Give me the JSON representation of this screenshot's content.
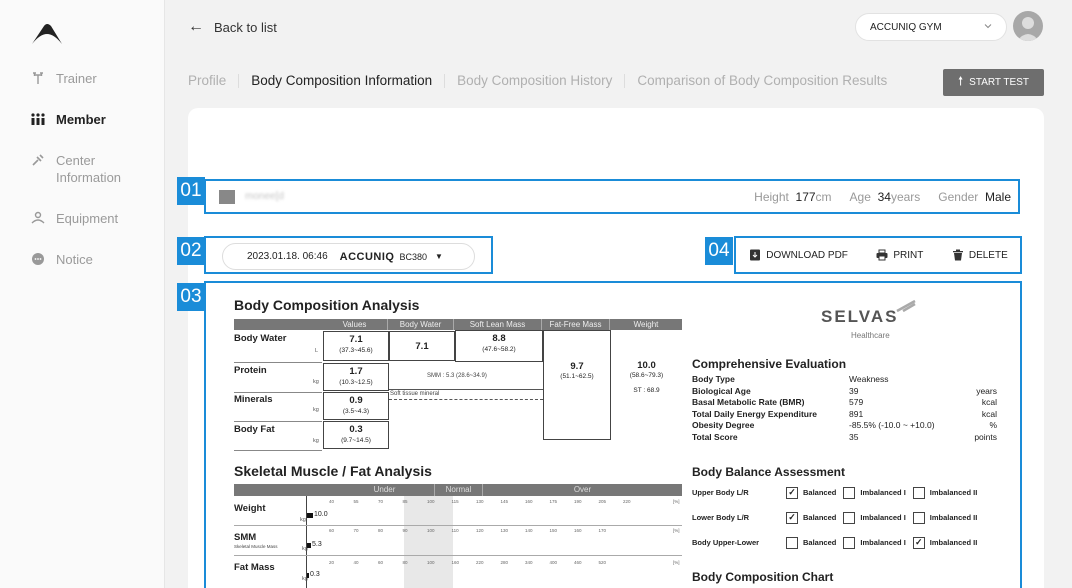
{
  "sidebar": {
    "items": [
      {
        "label": "Trainer",
        "icon": "dumbbell-icon",
        "active": false
      },
      {
        "label": "Member",
        "icon": "members-icon",
        "active": true
      },
      {
        "label": "Center Information",
        "icon": "center-icon",
        "active": false
      },
      {
        "label": "Equipment",
        "icon": "equipment-icon",
        "active": false
      },
      {
        "label": "Notice",
        "icon": "notice-icon",
        "active": false
      }
    ]
  },
  "header": {
    "back_label": "Back to list",
    "gym_select": "ACCUNIQ GYM"
  },
  "tabs": [
    {
      "label": "Profile",
      "active": false
    },
    {
      "label": "Body Composition Information",
      "active": true
    },
    {
      "label": "Body Composition History",
      "active": false
    },
    {
      "label": "Comparison of Body Composition Results",
      "active": false
    }
  ],
  "start_test_label": "START TEST",
  "badges": [
    "01",
    "02",
    "03",
    "04"
  ],
  "member": {
    "name": "monee[d",
    "height_label": "Height",
    "height_value": "177",
    "height_unit": "cm",
    "age_label": "Age",
    "age_value": "34",
    "age_unit": "years",
    "gender_label": "Gender",
    "gender_value": "Male"
  },
  "measurement": {
    "datetime": "2023.01.18. 06:46",
    "device": "ACCUNIQ",
    "model": "BC380"
  },
  "actions": {
    "download": "DOWNLOAD PDF",
    "print": "PRINT",
    "delete": "DELETE"
  },
  "report": {
    "bca_title": "Body Composition Analysis",
    "bca_headers": [
      "Values",
      "Body Water",
      "Soft Lean Mass",
      "Fat-Free Mass",
      "Weight"
    ],
    "rows": {
      "water": {
        "label": "Body Water",
        "unit": "L",
        "value": "7.1",
        "range": "(37.3~45.6)"
      },
      "protein": {
        "label": "Protein",
        "unit": "kg",
        "value": "1.7",
        "range": "(10.3~12.5)"
      },
      "minerals": {
        "label": "Minerals",
        "unit": "kg",
        "value": "0.9",
        "range": "(3.5~4.3)"
      },
      "fat": {
        "label": "Body Fat",
        "unit": "kg",
        "value": "0.3",
        "range": "(9.7~14.5)"
      }
    },
    "body_water_value": "7.1",
    "soft_lean_value": "8.8",
    "soft_lean_range": "(47.6~58.2)",
    "smm_note": "SMM : 5.3 (28.6~34.9)",
    "soft_tissue_note": "Soft tissue mineral",
    "ffm_value": "9.7",
    "ffm_range": "(51.1~62.5)",
    "weight_value": "10.0",
    "weight_range": "(58.6~79.3)",
    "st_note": "ST : 68.9",
    "sm_title": "Skeletal Muscle / Fat Analysis",
    "sm_headers": [
      "Under",
      "Normal",
      "Over"
    ],
    "sm_rows": [
      {
        "label": "Weight",
        "sub": "",
        "unit": "kg",
        "value": "10.0",
        "ticks": [
          "40",
          "55",
          "70",
          "85",
          "100",
          "115",
          "130",
          "145",
          "160",
          "175",
          "190",
          "205",
          "220"
        ],
        "pct": "[%]"
      },
      {
        "label": "SMM",
        "sub": "Skeletal Muscle Mass",
        "unit": "kg",
        "value": "5.3",
        "ticks": [
          "60",
          "70",
          "80",
          "90",
          "100",
          "110",
          "120",
          "130",
          "140",
          "150",
          "160",
          "170"
        ],
        "pct": "[%]"
      },
      {
        "label": "Fat Mass",
        "sub": "",
        "unit": "kg",
        "value": "0.3",
        "ticks": [
          "20",
          "40",
          "60",
          "80",
          "100",
          "160",
          "220",
          "280",
          "340",
          "400",
          "460",
          "520"
        ],
        "pct": "[%]"
      }
    ],
    "brand": "SELVAS",
    "brand_sub": "Healthcare",
    "ce_title": "Comprehensive Evaluation",
    "ce_rows": [
      {
        "k": "Body Type",
        "v": "Weakness",
        "u": ""
      },
      {
        "k": "Biological Age",
        "v": "39",
        "u": "years"
      },
      {
        "k": "Basal Metabolic Rate (BMR)",
        "v": "579",
        "u": "kcal"
      },
      {
        "k": "Total Daily Energy Expenditure",
        "v": "891",
        "u": "kcal"
      },
      {
        "k": "Obesity Degree",
        "v": "-85.5% (-10.0 ~ +10.0)",
        "u": "%"
      },
      {
        "k": "Total Score",
        "v": "35",
        "u": "points"
      }
    ],
    "bb_title": "Body Balance Assessment",
    "bb_rows": [
      {
        "label": "Upper Body L/R",
        "checked": 0
      },
      {
        "label": "Lower Body L/R",
        "checked": 0
      },
      {
        "label": "Body Upper-Lower",
        "checked": 2
      }
    ],
    "bb_options": [
      "Balanced",
      "Imbalanced I",
      "Imbalanced II"
    ],
    "bcc_title": "Body Composition Chart"
  },
  "colors": {
    "accent": "#1a8cd8",
    "start_button": "#6e6e6e"
  }
}
